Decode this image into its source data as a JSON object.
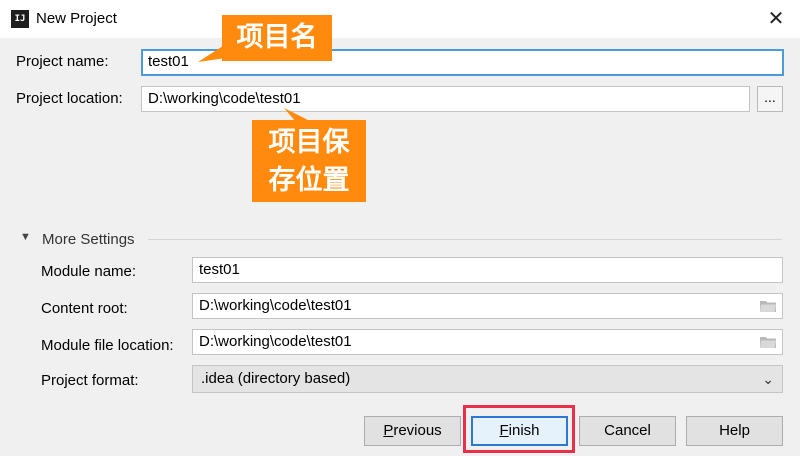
{
  "window": {
    "title": "New Project",
    "close_glyph": "✕",
    "app_icon_text": "IJ"
  },
  "callouts": {
    "project_name_note": "项目名",
    "location_note_line1": "项目保",
    "location_note_line2": "存位置"
  },
  "project": {
    "name_label": "Project name:",
    "name_value": "test01",
    "location_label": "Project location:",
    "location_value": "D:\\working\\code\\test01",
    "browse_label": "..."
  },
  "more_settings": {
    "title": "More Settings",
    "module_name_label": "Module name:",
    "module_name_value": "test01",
    "content_root_label": "Content root:",
    "content_root_value": "D:\\working\\code\\test01",
    "module_file_label": "Module file location:",
    "module_file_value": "D:\\working\\code\\test01",
    "format_label": "Project format:",
    "format_value": ".idea (directory based)"
  },
  "buttons": {
    "previous_first": "P",
    "previous_rest": "revious",
    "finish_first": "F",
    "finish_rest": "inish",
    "cancel": "Cancel",
    "help": "Help"
  },
  "colors": {
    "callout": "#ff8a0d",
    "highlight": "#e8304a",
    "focus": "#4a9bd8"
  },
  "icons": {
    "expand": "triangle-down-icon",
    "folder": "folder-icon",
    "dropdown": "chevron-down-icon"
  }
}
